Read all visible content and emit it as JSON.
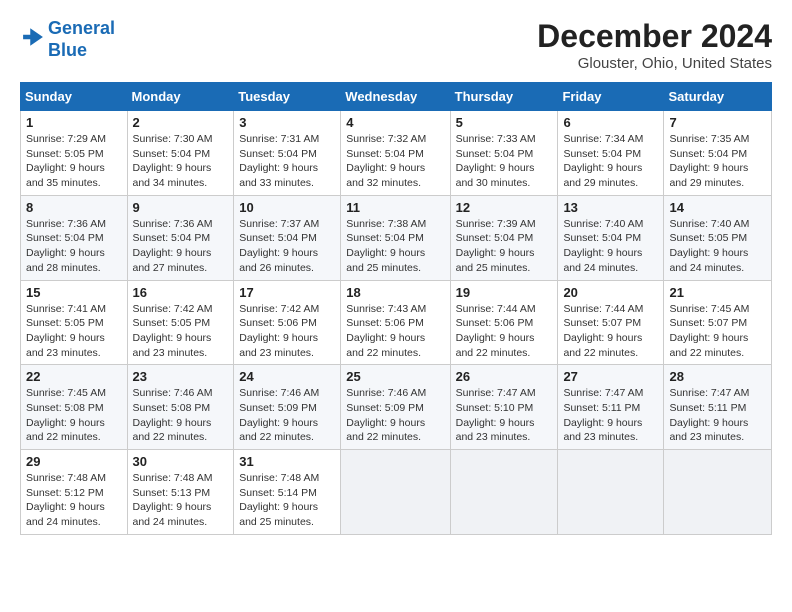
{
  "header": {
    "logo_line1": "General",
    "logo_line2": "Blue",
    "month": "December 2024",
    "location": "Glouster, Ohio, United States"
  },
  "days_of_week": [
    "Sunday",
    "Monday",
    "Tuesday",
    "Wednesday",
    "Thursday",
    "Friday",
    "Saturday"
  ],
  "weeks": [
    [
      {
        "day": "1",
        "info": "Sunrise: 7:29 AM\nSunset: 5:05 PM\nDaylight: 9 hours\nand 35 minutes."
      },
      {
        "day": "2",
        "info": "Sunrise: 7:30 AM\nSunset: 5:04 PM\nDaylight: 9 hours\nand 34 minutes."
      },
      {
        "day": "3",
        "info": "Sunrise: 7:31 AM\nSunset: 5:04 PM\nDaylight: 9 hours\nand 33 minutes."
      },
      {
        "day": "4",
        "info": "Sunrise: 7:32 AM\nSunset: 5:04 PM\nDaylight: 9 hours\nand 32 minutes."
      },
      {
        "day": "5",
        "info": "Sunrise: 7:33 AM\nSunset: 5:04 PM\nDaylight: 9 hours\nand 30 minutes."
      },
      {
        "day": "6",
        "info": "Sunrise: 7:34 AM\nSunset: 5:04 PM\nDaylight: 9 hours\nand 29 minutes."
      },
      {
        "day": "7",
        "info": "Sunrise: 7:35 AM\nSunset: 5:04 PM\nDaylight: 9 hours\nand 29 minutes."
      }
    ],
    [
      {
        "day": "8",
        "info": "Sunrise: 7:36 AM\nSunset: 5:04 PM\nDaylight: 9 hours\nand 28 minutes."
      },
      {
        "day": "9",
        "info": "Sunrise: 7:36 AM\nSunset: 5:04 PM\nDaylight: 9 hours\nand 27 minutes."
      },
      {
        "day": "10",
        "info": "Sunrise: 7:37 AM\nSunset: 5:04 PM\nDaylight: 9 hours\nand 26 minutes."
      },
      {
        "day": "11",
        "info": "Sunrise: 7:38 AM\nSunset: 5:04 PM\nDaylight: 9 hours\nand 25 minutes."
      },
      {
        "day": "12",
        "info": "Sunrise: 7:39 AM\nSunset: 5:04 PM\nDaylight: 9 hours\nand 25 minutes."
      },
      {
        "day": "13",
        "info": "Sunrise: 7:40 AM\nSunset: 5:04 PM\nDaylight: 9 hours\nand 24 minutes."
      },
      {
        "day": "14",
        "info": "Sunrise: 7:40 AM\nSunset: 5:05 PM\nDaylight: 9 hours\nand 24 minutes."
      }
    ],
    [
      {
        "day": "15",
        "info": "Sunrise: 7:41 AM\nSunset: 5:05 PM\nDaylight: 9 hours\nand 23 minutes."
      },
      {
        "day": "16",
        "info": "Sunrise: 7:42 AM\nSunset: 5:05 PM\nDaylight: 9 hours\nand 23 minutes."
      },
      {
        "day": "17",
        "info": "Sunrise: 7:42 AM\nSunset: 5:06 PM\nDaylight: 9 hours\nand 23 minutes."
      },
      {
        "day": "18",
        "info": "Sunrise: 7:43 AM\nSunset: 5:06 PM\nDaylight: 9 hours\nand 22 minutes."
      },
      {
        "day": "19",
        "info": "Sunrise: 7:44 AM\nSunset: 5:06 PM\nDaylight: 9 hours\nand 22 minutes."
      },
      {
        "day": "20",
        "info": "Sunrise: 7:44 AM\nSunset: 5:07 PM\nDaylight: 9 hours\nand 22 minutes."
      },
      {
        "day": "21",
        "info": "Sunrise: 7:45 AM\nSunset: 5:07 PM\nDaylight: 9 hours\nand 22 minutes."
      }
    ],
    [
      {
        "day": "22",
        "info": "Sunrise: 7:45 AM\nSunset: 5:08 PM\nDaylight: 9 hours\nand 22 minutes."
      },
      {
        "day": "23",
        "info": "Sunrise: 7:46 AM\nSunset: 5:08 PM\nDaylight: 9 hours\nand 22 minutes."
      },
      {
        "day": "24",
        "info": "Sunrise: 7:46 AM\nSunset: 5:09 PM\nDaylight: 9 hours\nand 22 minutes."
      },
      {
        "day": "25",
        "info": "Sunrise: 7:46 AM\nSunset: 5:09 PM\nDaylight: 9 hours\nand 22 minutes."
      },
      {
        "day": "26",
        "info": "Sunrise: 7:47 AM\nSunset: 5:10 PM\nDaylight: 9 hours\nand 23 minutes."
      },
      {
        "day": "27",
        "info": "Sunrise: 7:47 AM\nSunset: 5:11 PM\nDaylight: 9 hours\nand 23 minutes."
      },
      {
        "day": "28",
        "info": "Sunrise: 7:47 AM\nSunset: 5:11 PM\nDaylight: 9 hours\nand 23 minutes."
      }
    ],
    [
      {
        "day": "29",
        "info": "Sunrise: 7:48 AM\nSunset: 5:12 PM\nDaylight: 9 hours\nand 24 minutes."
      },
      {
        "day": "30",
        "info": "Sunrise: 7:48 AM\nSunset: 5:13 PM\nDaylight: 9 hours\nand 24 minutes."
      },
      {
        "day": "31",
        "info": "Sunrise: 7:48 AM\nSunset: 5:14 PM\nDaylight: 9 hours\nand 25 minutes."
      },
      {
        "day": "",
        "info": ""
      },
      {
        "day": "",
        "info": ""
      },
      {
        "day": "",
        "info": ""
      },
      {
        "day": "",
        "info": ""
      }
    ]
  ]
}
